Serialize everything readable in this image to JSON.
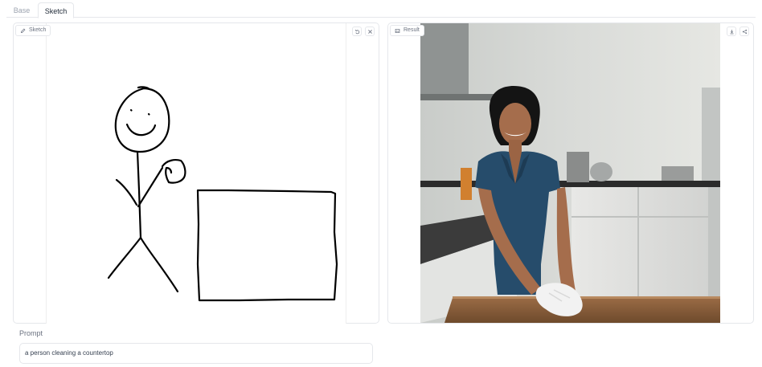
{
  "tabs": [
    {
      "label": "Base",
      "active": false
    },
    {
      "label": "Sketch",
      "active": true
    }
  ],
  "sketch_panel": {
    "label": "Sketch",
    "label_icon": "pencil-icon",
    "buttons": [
      {
        "name": "undo-button",
        "icon": "undo-icon"
      },
      {
        "name": "clear-button",
        "icon": "close-icon"
      }
    ]
  },
  "result_panel": {
    "label": "Result",
    "label_icon": "image-icon",
    "buttons": [
      {
        "name": "download-button",
        "icon": "download-icon"
      },
      {
        "name": "share-button",
        "icon": "share-icon"
      }
    ]
  },
  "prompt": {
    "label": "Prompt",
    "value": "a person cleaning a countertop"
  },
  "colors": {
    "border": "#e5e7eb",
    "text_muted": "#6b7280",
    "text": "#374151",
    "ink": "#000000"
  }
}
